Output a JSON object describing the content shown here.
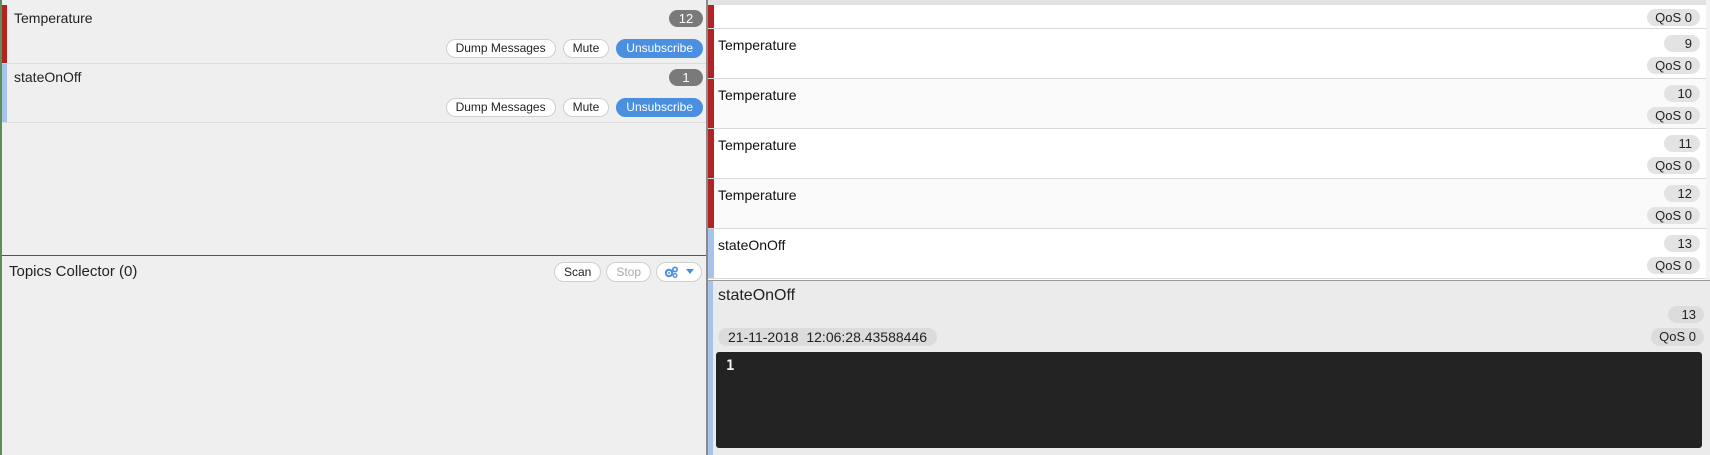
{
  "colors": {
    "temperature": "#b22424",
    "stateOnOff": "#a8c4e8",
    "primary_button": "#4a8fe0",
    "count_badge": "#7a7a7a",
    "payload_bg": "#232323"
  },
  "subscriptions": [
    {
      "topic": "Temperature",
      "count": "12",
      "dump_label": "Dump Messages",
      "mute_label": "Mute",
      "unsubscribe_label": "Unsubscribe"
    },
    {
      "topic": "stateOnOff",
      "count": "1",
      "dump_label": "Dump Messages",
      "mute_label": "Mute",
      "unsubscribe_label": "Unsubscribe"
    }
  ],
  "topics_collector": {
    "title": "Topics Collector (0)",
    "scan_label": "Scan",
    "stop_label": "Stop",
    "options_icon": "gears-icon"
  },
  "messages": [
    {
      "topic": "",
      "num": "",
      "qos": "QoS 0"
    },
    {
      "topic": "Temperature",
      "num": "9",
      "qos": "QoS 0"
    },
    {
      "topic": "Temperature",
      "num": "10",
      "qos": "QoS 0"
    },
    {
      "topic": "Temperature",
      "num": "11",
      "qos": "QoS 0"
    },
    {
      "topic": "Temperature",
      "num": "12",
      "qos": "QoS 0"
    },
    {
      "topic": "stateOnOff",
      "num": "13",
      "qos": "QoS 0"
    }
  ],
  "detail": {
    "topic": "stateOnOff",
    "num": "13",
    "timestamp": "21-11-2018  12:06:28.43588446",
    "qos": "QoS 0",
    "payload": "1"
  }
}
